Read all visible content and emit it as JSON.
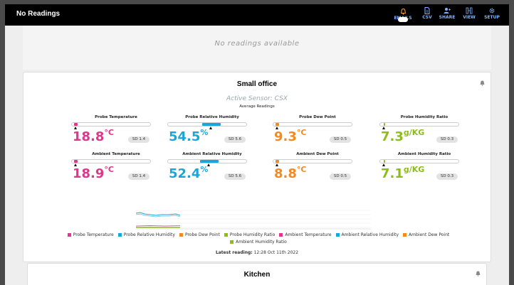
{
  "page_title": "No Readings",
  "nav": [
    {
      "label": "EMAILS",
      "icon": "email-toggle-icon"
    },
    {
      "label": "CSV",
      "icon": "document-icon"
    },
    {
      "label": "SHARE",
      "icon": "share-user-icon"
    },
    {
      "label": "VIEW",
      "icon": "view-icon"
    },
    {
      "label": "SETUP",
      "icon": "gear-icon"
    }
  ],
  "no_readings_text": "No readings available",
  "office": {
    "title": "Small office",
    "active_sensor": "Active Sensor: CSX",
    "average_label": "Average Readings",
    "metrics": [
      {
        "label": "Probe Temperature",
        "value": "18.8",
        "unit": "°C",
        "sd": "SD 1.4",
        "color": "#d93a8c",
        "level": 0.05
      },
      {
        "label": "Probe Relative Humidity",
        "value": "54.5",
        "unit": "%",
        "sd": "SD 5.6",
        "color": "#1aa6d9",
        "level": 0.55
      },
      {
        "label": "Probe Dew Point",
        "value": "9.3",
        "unit": "°C",
        "sd": "SD 0.5",
        "color": "#f08a24",
        "level": 0.05
      },
      {
        "label": "Probe Humidity Ratio",
        "value": "7.3",
        "unit": "g/KG",
        "sd": "SD 0.3",
        "color": "#8cbd1d",
        "level": 0.05
      },
      {
        "label": "Ambient Temperature",
        "value": "18.9",
        "unit": "°C",
        "sd": "SD 1.4",
        "color": "#d93a8c",
        "level": 0.05
      },
      {
        "label": "Ambient Relative Humidity",
        "value": "52.4",
        "unit": "%",
        "sd": "SD 5.6",
        "color": "#1aa6d9",
        "level": 0.53
      },
      {
        "label": "Ambient Dew Point",
        "value": "8.8",
        "unit": "°C",
        "sd": "SD 0.5",
        "color": "#f08a24",
        "level": 0.05
      },
      {
        "label": "Ambient Humidity Ratio",
        "value": "7.1",
        "unit": "g/KG",
        "sd": "SD 0.3",
        "color": "#8cbd1d",
        "level": 0.05
      }
    ],
    "legend": [
      {
        "label": "Probe Temperature",
        "color": "#d93a8c"
      },
      {
        "label": "Probe Relative Humidity",
        "color": "#1aa6d9"
      },
      {
        "label": "Probe Dew Point",
        "color": "#f08a24"
      },
      {
        "label": "Probe Humidity Ratio",
        "color": "#8cbd1d"
      },
      {
        "label": "Ambient Temperature",
        "color": "#d93a8c"
      },
      {
        "label": "Ambient Relative Humidity",
        "color": "#1aa6d9"
      },
      {
        "label": "Ambient Dew Point",
        "color": "#f08a24"
      },
      {
        "label": "Ambient Humidity Ratio",
        "color": "#8cbd1d"
      }
    ],
    "latest_label": "Latest reading:",
    "latest_value": "12:28 Oct 11th 2022"
  },
  "kitchen": {
    "title": "Kitchen"
  }
}
